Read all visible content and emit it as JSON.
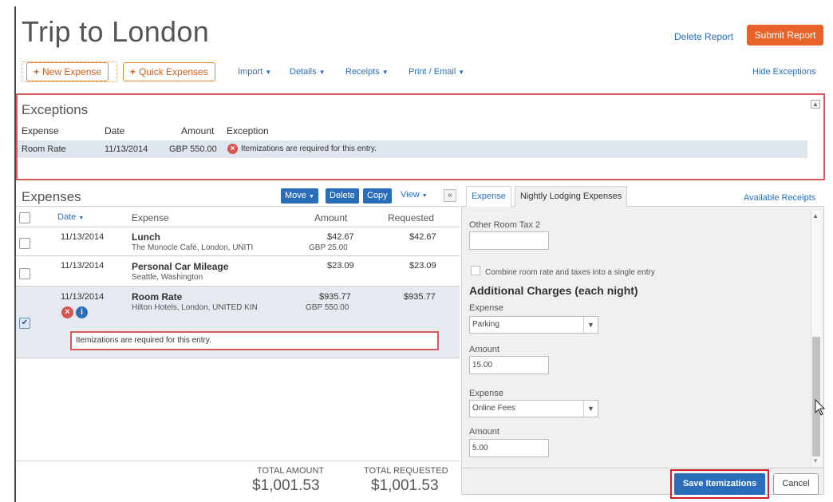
{
  "header": {
    "title": "Trip to London",
    "delete_report": "Delete Report",
    "submit_report": "Submit Report",
    "hide_exceptions": "Hide Exceptions"
  },
  "toolbar": {
    "new_expense": "New Expense",
    "quick_expenses": "Quick Expenses",
    "import": "Import",
    "details": "Details",
    "receipts": "Receipts",
    "print_email": "Print / Email"
  },
  "exceptions": {
    "title": "Exceptions",
    "columns": [
      "Expense",
      "Date",
      "Amount",
      "Exception"
    ],
    "rows": [
      {
        "expense": "Room Rate",
        "date": "11/13/2014",
        "amount": "GBP 550.00",
        "exception": "Itemizations are required for this entry."
      }
    ]
  },
  "expenses": {
    "title": "Expenses",
    "move": "Move",
    "delete": "Delete",
    "copy": "Copy",
    "view": "View",
    "columns": {
      "date": "Date",
      "expense": "Expense",
      "amount": "Amount",
      "requested": "Requested"
    },
    "rows": [
      {
        "date": "11/13/2014",
        "name": "Lunch",
        "detail": "The Monocle Café, London, UNITI",
        "amount": "$42.67",
        "amount2": "GBP 25.00",
        "requested": "$42.67",
        "checked": false
      },
      {
        "date": "11/13/2014",
        "name": "Personal Car Mileage",
        "detail": "Seattle, Washington",
        "amount": "$23.09",
        "amount2": "",
        "requested": "$23.09",
        "checked": false
      },
      {
        "date": "11/13/2014",
        "name": "Room Rate",
        "detail": "Hilton Hotels, London, UNITED KIN",
        "amount": "$935.77",
        "amount2": "GBP 550.00",
        "requested": "$935.77",
        "checked": true
      }
    ],
    "row_exception": "Itemizations are required for this entry.",
    "total_amount_label": "TOTAL AMOUNT",
    "total_amount": "$1,001.53",
    "total_requested_label": "TOTAL REQUESTED",
    "total_requested": "$1,001.53"
  },
  "right_panel": {
    "tab_expense": "Expense",
    "tab_nightly": "Nightly Lodging Expenses",
    "available_receipts": "Available Receipts",
    "other_room_tax_label": "Other Room Tax 2",
    "other_room_tax_value": "",
    "combine_label": "Combine room rate and taxes into a single entry",
    "additional_charges": "Additional Charges (each night)",
    "charge1": {
      "expense_label": "Expense",
      "expense_value": "Parking",
      "amount_label": "Amount",
      "amount_value": "15.00"
    },
    "charge2": {
      "expense_label": "Expense",
      "expense_value": "Online Fees",
      "amount_label": "Amount",
      "amount_value": "5.00"
    },
    "save_itemizations": "Save Itemizations",
    "cancel": "Cancel"
  },
  "icons": {
    "error": "error-icon",
    "info": "info-icon",
    "caret": "caret-down-icon",
    "collapse": "collapse-up-icon",
    "double_left": "double-chevron-left-icon",
    "mouse": "mouse-pointer-icon"
  },
  "colors": {
    "accent_blue": "#2a6ebb",
    "submit_orange": "#e8632a",
    "error_red": "#d9534f",
    "highlight_red": "#d41f2a"
  }
}
